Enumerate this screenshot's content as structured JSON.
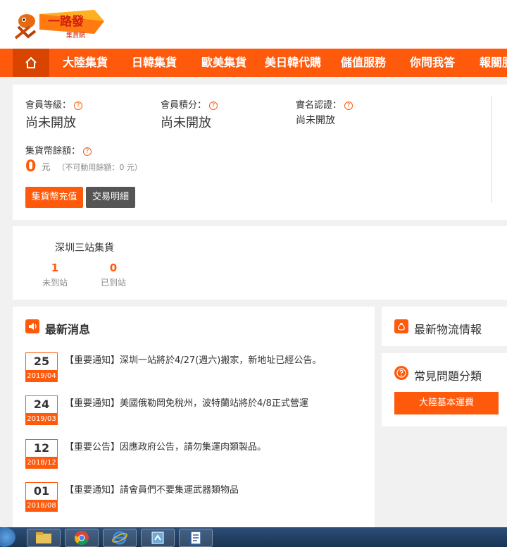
{
  "nav": {
    "items": [
      {
        "label": "大陸集貨"
      },
      {
        "label": "日韓集貨"
      },
      {
        "label": "歐美集貨"
      },
      {
        "label": "美日韓代購"
      },
      {
        "label": "儲值服務"
      },
      {
        "label": "你問我答"
      },
      {
        "label": "報關服"
      }
    ]
  },
  "member": {
    "level_label": "會員等級：",
    "level_value": "尚未開放",
    "points_label": "會員積分：",
    "points_value": "尚未開放",
    "realname_label": "實名認證：",
    "realname_value": "尚未開放",
    "balance_label": "集貨幣餘額：",
    "balance_value": "0",
    "balance_unit": "元",
    "balance_note": "（不可動用餘額：0 元）",
    "recharge_button": "集貨幣充值",
    "transactions_button": "交易明細",
    "help_glyph": "?"
  },
  "warehouse": {
    "title": "深圳三站集貨",
    "not_arrived_count": "1",
    "not_arrived_label": "未到站",
    "arrived_count": "0",
    "arrived_label": "已到站"
  },
  "news": {
    "title": "最新消息",
    "items": [
      {
        "day": "25",
        "ym": "2019/04",
        "text": "【重要通知】深圳一站將於4/27(週六)搬家，新地址已經公告。"
      },
      {
        "day": "24",
        "ym": "2019/03",
        "text": "【重要通知】美國俄勒岡免稅州，波特蘭站將於4/8正式營運"
      },
      {
        "day": "12",
        "ym": "2018/12",
        "text": "【重要公告】因應政府公告，請勿集運肉類製品。"
      },
      {
        "day": "01",
        "ym": "2018/08",
        "text": "【重要通知】請會員們不要集運武器類物品"
      }
    ]
  },
  "logistics": {
    "title": "最新物流情報"
  },
  "faq": {
    "title": "常見問題分類",
    "button": "大陸基本運費"
  },
  "colors": {
    "accent": "#ff5a0c",
    "accent_dark": "#d94500",
    "dark_button": "#555555"
  }
}
